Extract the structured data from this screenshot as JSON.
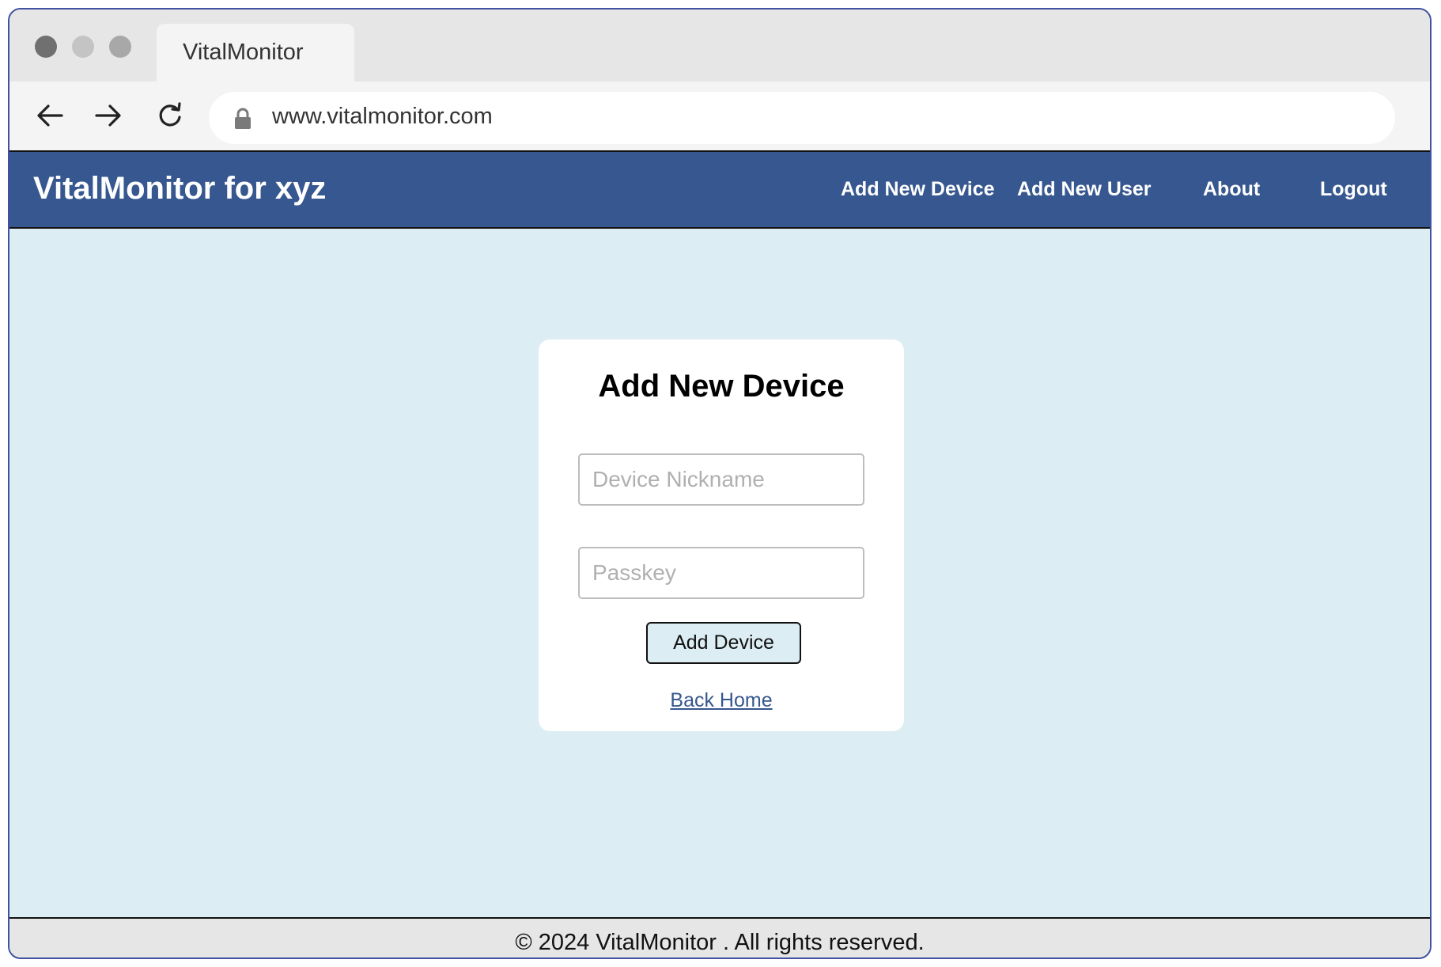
{
  "browser": {
    "tab_title": "VitalMonitor",
    "url": "www.vitalmonitor.com"
  },
  "app": {
    "brand": "VitalMonitor for xyz",
    "nav": {
      "add_device": "Add New Device",
      "add_user": "Add New User",
      "about": "About",
      "logout": "Logout"
    },
    "colors": {
      "nav_bg": "#36578f",
      "page_bg": "#dcedf3",
      "footer_bg": "#e6e6e6"
    }
  },
  "form": {
    "title": "Add New Device",
    "nickname_placeholder": "Device Nickname",
    "passkey_placeholder": "Passkey",
    "submit_label": "Add Device",
    "back_link": "Back Home"
  },
  "footer": {
    "text": "© 2024 VitalMonitor . All rights reserved."
  }
}
